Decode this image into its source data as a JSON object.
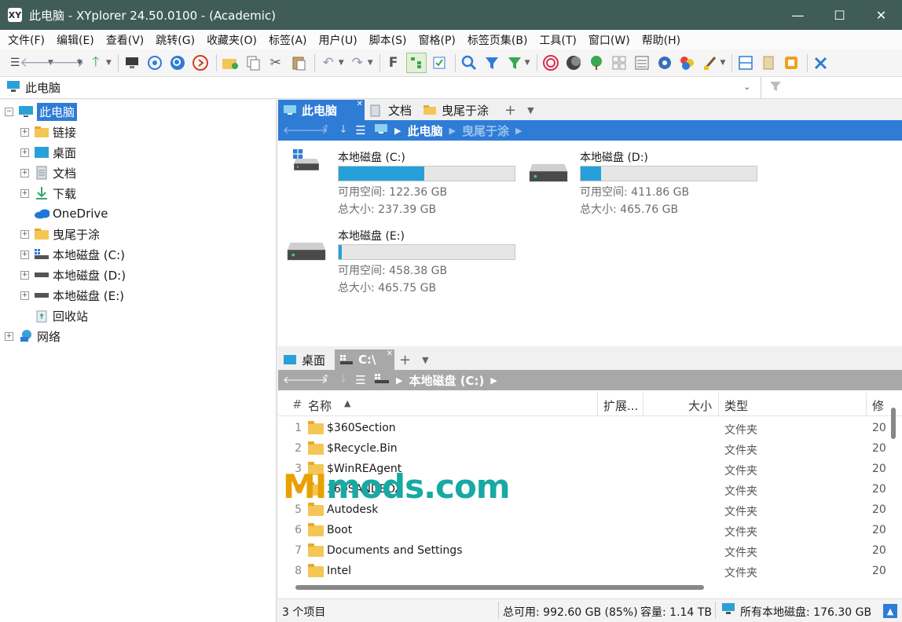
{
  "window": {
    "title": "此电脑 - XYplorer 24.50.0100 - (Academic)",
    "app_icon_text": "XY",
    "controls": [
      "—",
      "☐",
      "✕"
    ]
  },
  "menu": [
    "文件(F)",
    "编辑(E)",
    "查看(V)",
    "跳转(G)",
    "收藏夹(O)",
    "标签(A)",
    "用户(U)",
    "脚本(S)",
    "窗格(P)",
    "标签页集(B)",
    "工具(T)",
    "窗口(W)",
    "帮助(H)"
  ],
  "address": {
    "text": "此电脑"
  },
  "tree": {
    "items": [
      {
        "label": "此电脑"
      },
      {
        "label": "链接"
      },
      {
        "label": "桌面"
      },
      {
        "label": "文档"
      },
      {
        "label": "下载"
      },
      {
        "label": "OneDrive"
      },
      {
        "label": "曳尾于涂"
      },
      {
        "label": "本地磁盘 (C:)"
      },
      {
        "label": "本地磁盘 (D:)"
      },
      {
        "label": "本地磁盘 (E:)"
      },
      {
        "label": "回收站"
      },
      {
        "label": "网络"
      }
    ]
  },
  "top_pane": {
    "tabs": [
      {
        "label": "此电脑"
      },
      {
        "label": "文档"
      },
      {
        "label": "曳尾于涂"
      }
    ],
    "crumbs": [
      "此电脑",
      "曳尾于涂"
    ],
    "drives": [
      {
        "name": "本地磁盘 (C:)",
        "used_fraction": 0.485,
        "free": "可用空间: 122.36 GB",
        "total": "总大小: 237.39 GB"
      },
      {
        "name": "本地磁盘 (D:)",
        "used_fraction": 0.115,
        "free": "可用空间: 411.86 GB",
        "total": "总大小: 465.76 GB"
      },
      {
        "name": "本地磁盘 (E:)",
        "used_fraction": 0.016,
        "free": "可用空间: 458.38 GB",
        "total": "总大小: 465.75 GB"
      }
    ]
  },
  "bottom_pane": {
    "tabs": [
      {
        "label": "桌面"
      },
      {
        "label": "C:\\"
      }
    ],
    "crumb": "本地磁盘 (C:)",
    "columns": {
      "num": "#",
      "name": "名称",
      "ext": "扩展...",
      "size": "大小",
      "type": "类型",
      "modified": "修"
    },
    "rows": [
      {
        "num": "1",
        "name": "$360Section",
        "type": "文件夹",
        "mod": "20"
      },
      {
        "num": "2",
        "name": "$Recycle.Bin",
        "type": "文件夹",
        "mod": "20"
      },
      {
        "num": "3",
        "name": "$WinREAgent",
        "type": "文件夹",
        "mod": "20"
      },
      {
        "num": "4",
        "name": "360SANDBOX",
        "type": "文件夹",
        "mod": "20"
      },
      {
        "num": "5",
        "name": "Autodesk",
        "type": "文件夹",
        "mod": "20"
      },
      {
        "num": "6",
        "name": "Boot",
        "type": "文件夹",
        "mod": "20"
      },
      {
        "num": "7",
        "name": "Documents and Settings",
        "type": "文件夹",
        "mod": "20"
      },
      {
        "num": "8",
        "name": "Intel",
        "type": "文件夹",
        "mod": "20"
      }
    ]
  },
  "status": {
    "items": "3 个项目",
    "free": "总可用: 992.60 GB (85%)",
    "capacity": "容量: 1.14 TB",
    "all_drives": "所有本地磁盘: 176.30 GB"
  },
  "watermark": {
    "mi": "MI",
    "rest": "mods.com"
  }
}
